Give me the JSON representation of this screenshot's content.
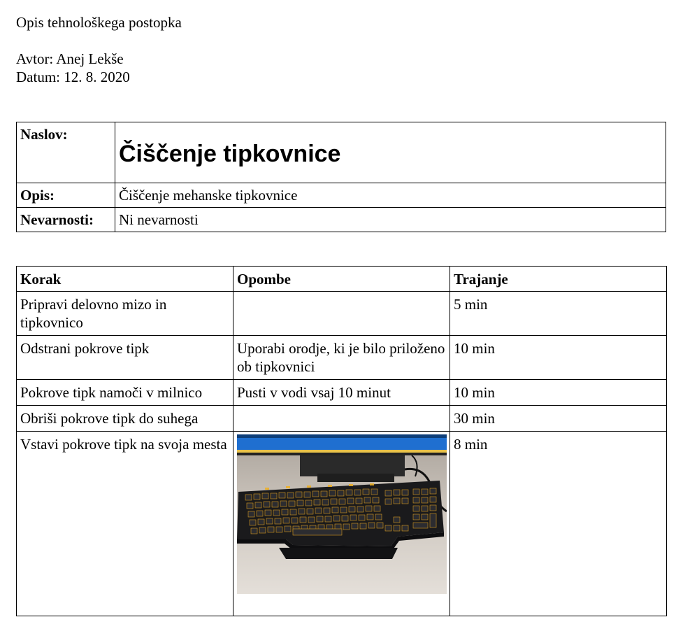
{
  "header": {
    "doc_type": "Opis tehnološkega postopka",
    "author_line": "Avtor: Anej Lekše",
    "date_line": "Datum: 12. 8. 2020"
  },
  "info": {
    "title_label": "Naslov:",
    "title_value": "Čiščenje tipkovnice",
    "description_label": "Opis:",
    "description_value": "Čiščenje mehanske tipkovnice",
    "hazards_label": "Nevarnosti:",
    "hazards_value": "Ni nevarnosti"
  },
  "steps": {
    "headers": [
      "Korak",
      "Opombe",
      "Trajanje"
    ],
    "rows": [
      {
        "step": "Pripravi delovno mizo in tipkovnico",
        "note": "",
        "duration": "5 min"
      },
      {
        "step": "Odstrani pokrove tipk",
        "note": "Uporabi orodje, ki je bilo priloženo ob tipkovnici",
        "duration": "10 min"
      },
      {
        "step": "Pokrove tipk namoči v milnico",
        "note": "Pusti v vodi vsaj 10 minut",
        "duration": "10 min"
      },
      {
        "step": "Obriši pokrove tipk do suhega",
        "note": "",
        "duration": "30 min"
      },
      {
        "step": "Vstavi pokrove tipk na svoja mesta",
        "note": "",
        "duration": "8 min"
      }
    ]
  },
  "photo": {
    "icon": "keyboard-photo",
    "colors": {
      "desk": "#d6d0c9",
      "keyboard": "#1c1c1e",
      "backlight": "#e0a020",
      "screen": "#1f6fd0"
    }
  }
}
